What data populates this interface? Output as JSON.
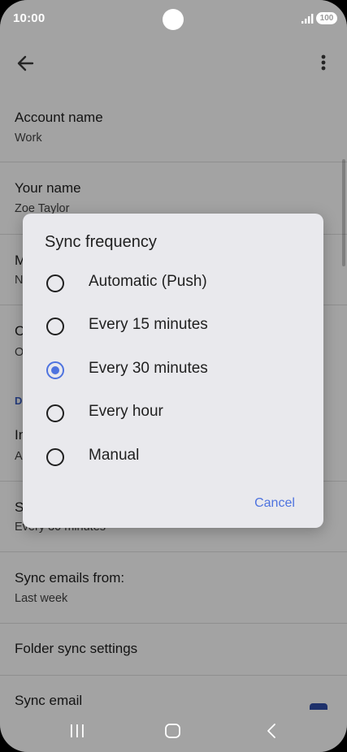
{
  "status_bar": {
    "time": "10:00",
    "battery": "100"
  },
  "settings": [
    {
      "title": "Account name",
      "value": "Work"
    },
    {
      "title": "Your name",
      "value": "Zoe Taylor"
    },
    {
      "title": "M",
      "value": "N"
    },
    {
      "title": "C",
      "value": "O"
    },
    {
      "section": "D"
    },
    {
      "title": "In",
      "value": "A"
    },
    {
      "title": "S",
      "value": "Every 30 minutes"
    },
    {
      "title": "Sync emails from:",
      "value": "Last week"
    },
    {
      "title": "Folder sync settings"
    },
    {
      "title": "Sync email"
    }
  ],
  "dialog": {
    "title": "Sync frequency",
    "options": [
      {
        "label": "Automatic (Push)",
        "selected": false
      },
      {
        "label": "Every 15 minutes",
        "selected": false
      },
      {
        "label": "Every 30 minutes",
        "selected": true
      },
      {
        "label": "Every hour",
        "selected": false
      },
      {
        "label": "Manual",
        "selected": false
      }
    ],
    "cancel_label": "Cancel"
  },
  "colors": {
    "accent": "#4e73df",
    "section_header": "#3b5fc4",
    "dialog_bg": "#e9e9ed"
  },
  "icons": {
    "back": "arrow-left-icon",
    "more": "more-vert-icon",
    "signal": "signal-icon",
    "recent": "recent-apps-icon",
    "home": "home-icon",
    "nav_back": "chevron-left-icon"
  }
}
